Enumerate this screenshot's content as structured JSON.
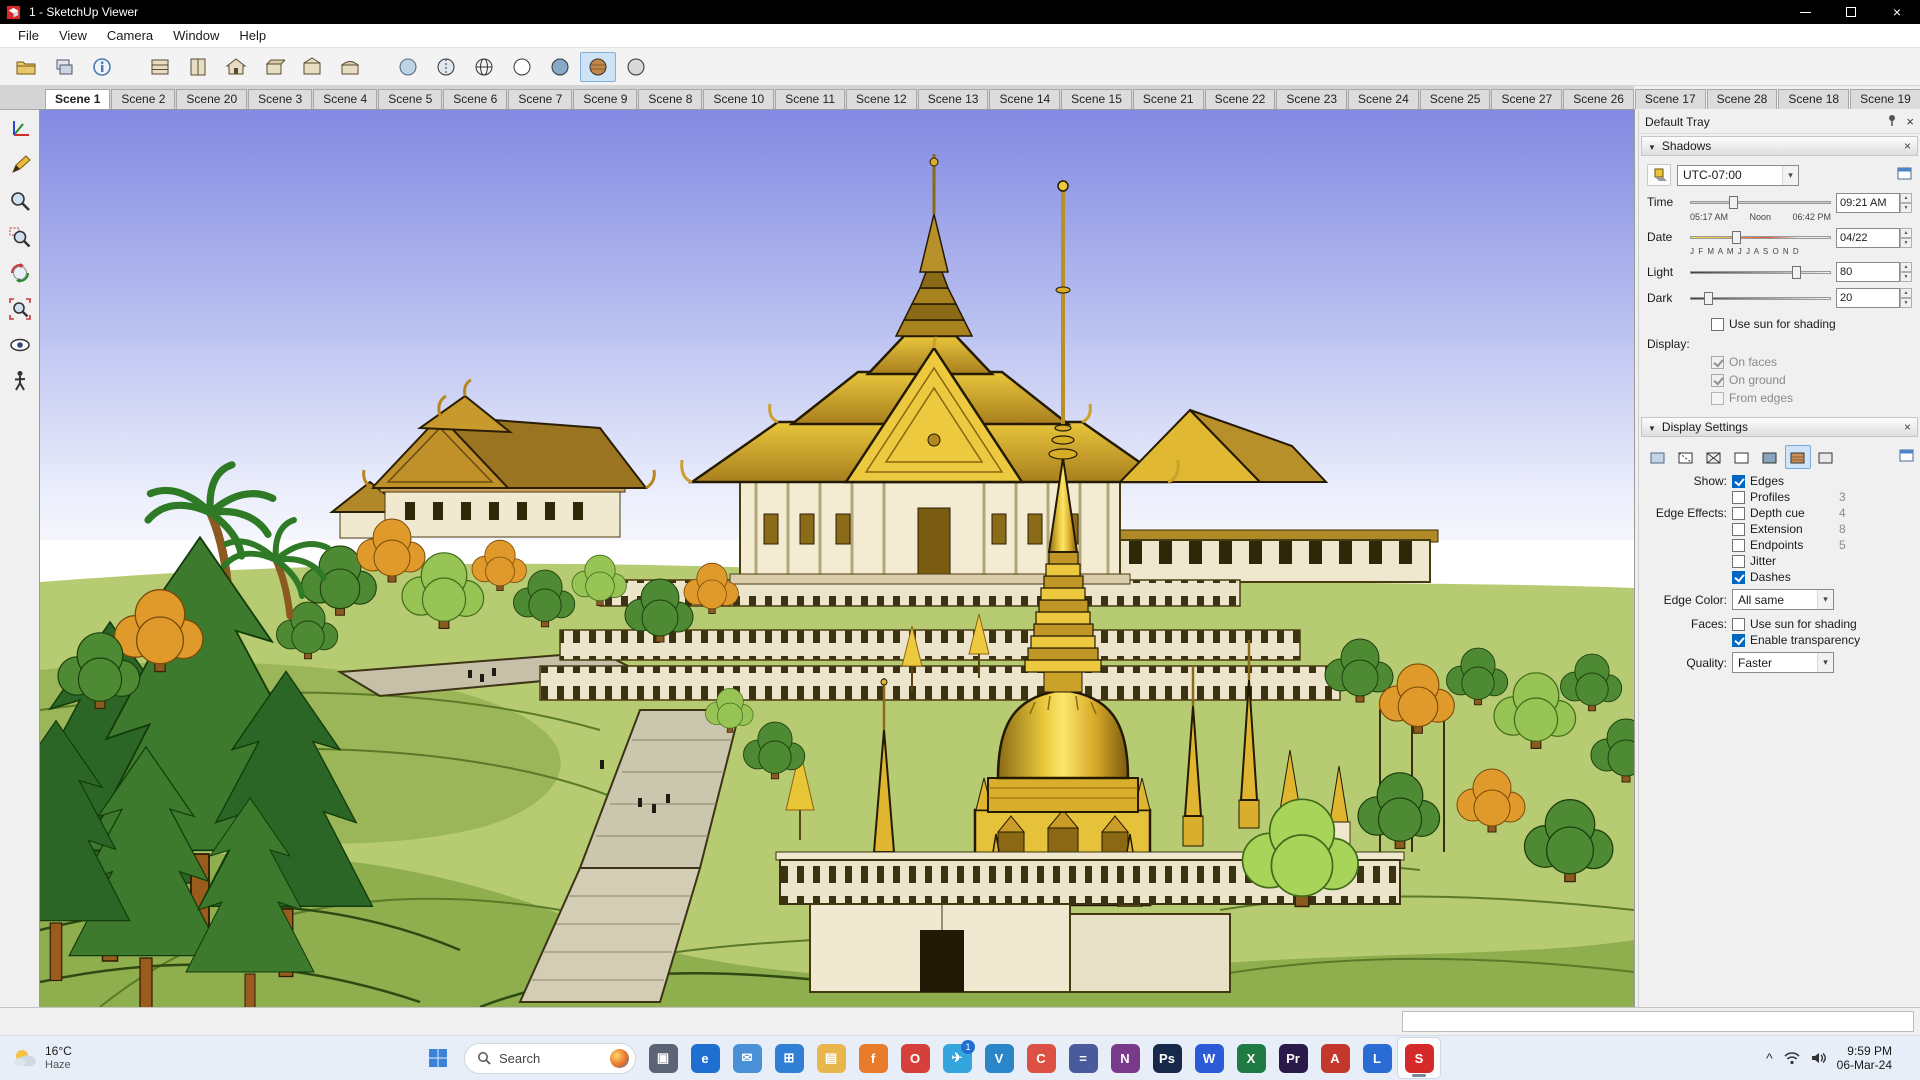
{
  "window": {
    "title": "1 - SketchUp Viewer",
    "close_glyph": "×"
  },
  "menu": {
    "items": [
      "File",
      "View",
      "Camera",
      "Window",
      "Help"
    ]
  },
  "scene_tabs": [
    {
      "label": "Scene 1",
      "active": true
    },
    {
      "label": "Scene 2"
    },
    {
      "label": "Scene 20"
    },
    {
      "label": "Scene 3"
    },
    {
      "label": "Scene 4"
    },
    {
      "label": "Scene 5"
    },
    {
      "label": "Scene 6"
    },
    {
      "label": "Scene 7"
    },
    {
      "label": "Scene 9"
    },
    {
      "label": "Scene 8"
    },
    {
      "label": "Scene 10"
    },
    {
      "label": "Scene 11"
    },
    {
      "label": "Scene 12"
    },
    {
      "label": "Scene 13"
    },
    {
      "label": "Scene 14"
    },
    {
      "label": "Scene 15"
    },
    {
      "label": "Scene 21"
    },
    {
      "label": "Scene 22"
    },
    {
      "label": "Scene 23"
    },
    {
      "label": "Scene 24"
    },
    {
      "label": "Scene 25"
    },
    {
      "label": "Scene 27"
    },
    {
      "label": "Scene 26"
    },
    {
      "label": "Scene 17"
    },
    {
      "label": "Scene 28"
    },
    {
      "label": "Scene 18"
    },
    {
      "label": "Scene 19"
    }
  ],
  "tray": {
    "title": "Default Tray",
    "shadows": {
      "title": "Shadows",
      "timezone": "UTC-07:00",
      "time_label": "Time",
      "time_start": "05:17 AM",
      "time_mid": "Noon",
      "time_end": "06:42 PM",
      "time_value": "09:21 AM",
      "date_label": "Date",
      "date_months": "J F M A M J J A S O N D",
      "date_value": "04/22",
      "light_label": "Light",
      "light_value": "80",
      "dark_label": "Dark",
      "dark_value": "20",
      "use_sun": {
        "label": "Use sun for shading",
        "state": "off"
      },
      "display_label": "Display:",
      "on_faces": {
        "label": "On faces",
        "state": "don"
      },
      "on_ground": {
        "label": "On ground",
        "state": "don"
      },
      "from_edges": {
        "label": "From edges",
        "state": "doff"
      }
    },
    "display_settings": {
      "title": "Display Settings",
      "show_label": "Show:",
      "edges": {
        "label": "Edges",
        "state": "on"
      },
      "profiles": {
        "label": "Profiles",
        "state": "off",
        "value": "3"
      },
      "edge_effects_label": "Edge Effects:",
      "depth_cue": {
        "label": "Depth cue",
        "state": "off",
        "value": "4"
      },
      "extension": {
        "label": "Extension",
        "state": "off",
        "value": "8"
      },
      "endpoints": {
        "label": "Endpoints",
        "state": "off",
        "value": "5"
      },
      "jitter": {
        "label": "Jitter",
        "state": "off"
      },
      "dashes": {
        "label": "Dashes",
        "state": "on"
      },
      "edge_color_label": "Edge Color:",
      "edge_color_value": "All same",
      "faces_label": "Faces:",
      "faces_use_sun": {
        "label": "Use sun for shading",
        "state": "off"
      },
      "enable_transparency": {
        "label": "Enable transparency",
        "state": "on"
      },
      "quality_label": "Quality:",
      "quality_value": "Faster"
    }
  },
  "taskbar": {
    "weather": {
      "temp": "16°C",
      "desc": "Haze"
    },
    "search": {
      "placeholder": "Search"
    },
    "apps": [
      {
        "name": "monitor",
        "glyph": "▣",
        "bg": "#5a6472"
      },
      {
        "name": "edge",
        "glyph": "e",
        "bg": "#1f6fd0"
      },
      {
        "name": "mail",
        "glyph": "✉",
        "bg": "#4a90d9"
      },
      {
        "name": "store",
        "glyph": "⊞",
        "bg": "#2f7fd4"
      },
      {
        "name": "explorer",
        "glyph": "▤",
        "bg": "#e8b64c"
      },
      {
        "name": "firefox",
        "glyph": "f",
        "bg": "#e87a2c"
      },
      {
        "name": "opera",
        "glyph": "O",
        "bg": "#d6403a"
      },
      {
        "name": "telegram",
        "glyph": "✈",
        "bg": "#34a6dd",
        "badge": "1"
      },
      {
        "name": "vscode",
        "glyph": "V",
        "bg": "#2a86c8"
      },
      {
        "name": "chrome",
        "glyph": "C",
        "bg": "#dd5144"
      },
      {
        "name": "calculator",
        "glyph": "=",
        "bg": "#4a5a9a"
      },
      {
        "name": "onenote",
        "glyph": "N",
        "bg": "#7a3a8a"
      },
      {
        "name": "photoshop",
        "glyph": "Ps",
        "bg": "#17294a"
      },
      {
        "name": "word",
        "glyph": "W",
        "bg": "#2b5bd7"
      },
      {
        "name": "excel",
        "glyph": "X",
        "bg": "#1f7a44"
      },
      {
        "name": "premiere",
        "glyph": "Pr",
        "bg": "#2a1a4a"
      },
      {
        "name": "acrobat",
        "glyph": "A",
        "bg": "#c4372c"
      },
      {
        "name": "layout",
        "glyph": "L",
        "bg": "#2a6bd4"
      },
      {
        "name": "sketchup",
        "glyph": "S",
        "bg": "#d42a2a",
        "active": true
      }
    ],
    "clock": {
      "time": "9:59 PM",
      "date": "06-Mar-24"
    }
  }
}
